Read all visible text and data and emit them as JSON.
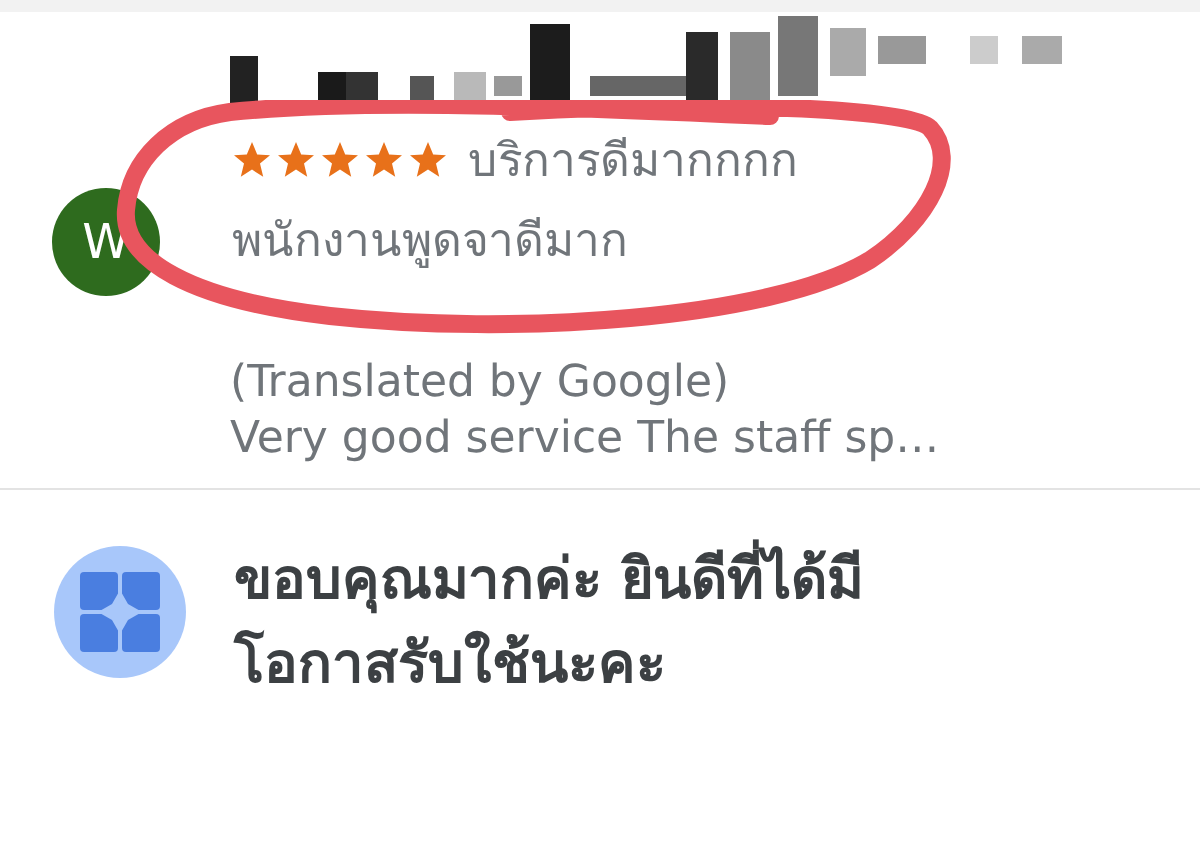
{
  "review": {
    "avatar_letter": "W",
    "stars": 5,
    "text_line_1": "บริการดีมากกกก",
    "text_line_2": "พนักงานพูดจาดีมาก",
    "translation_note": "(Translated by Google)",
    "translation": "Very good service The staff sp…"
  },
  "reply": {
    "text": "ขอบคุณมากค่ะ ยินดีที่ได้มี โอกาสรับใช้นะคะ"
  }
}
